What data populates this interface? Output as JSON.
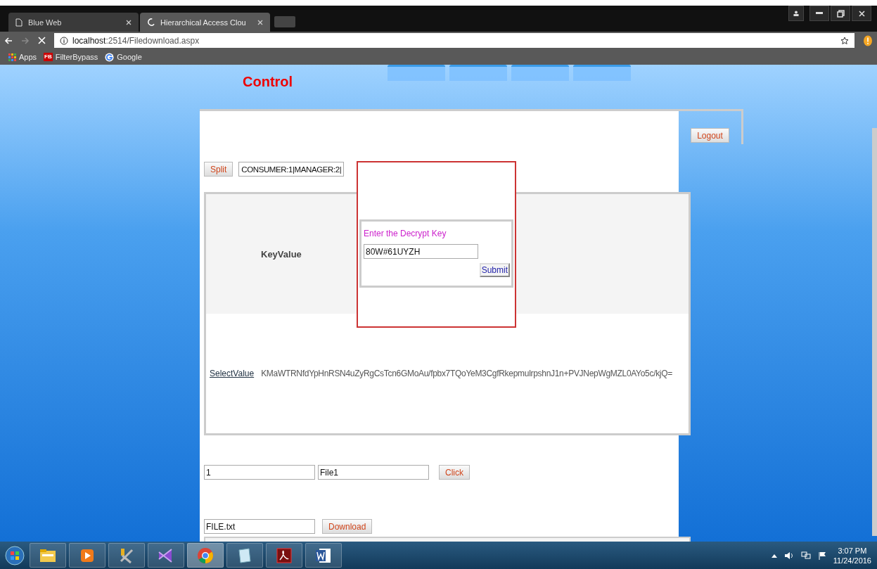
{
  "browser": {
    "tabs": [
      {
        "title": "Blue Web",
        "selected": false
      },
      {
        "title": "Hierarchical Access Clou",
        "selected": true
      }
    ],
    "url": {
      "host": "localhost",
      "path": ":2514/Filedownload.aspx"
    },
    "bookmarks": [
      {
        "label": "Apps",
        "kind": "apps"
      },
      {
        "label": "FilterBypass",
        "kind": "fb",
        "badge": "FB"
      },
      {
        "label": "Google",
        "kind": "google"
      }
    ]
  },
  "page": {
    "title": "Control",
    "logout": "Logout",
    "split": {
      "button": "Split",
      "value": "CONSUMER:1|MANAGER:2|"
    },
    "table": {
      "key_label": "KeyValue",
      "select_link": "SelectValue",
      "select_value": "KMaWTRNfdYpHnRSN4uZyRgCsTcn6GMoAu/fpbx7TQoYeM3CgfRkepmulrpshnJ1n+PVJNepWgMZL0AYo5c/kjQ="
    },
    "dialog": {
      "prompt": "Enter the Decrypt Key",
      "key": "80W#61UYZH",
      "submit": "Submit"
    },
    "file_form": {
      "id": "1",
      "name": "File1",
      "button": "Click"
    },
    "download": {
      "file": "FILE.txt",
      "button": "Download"
    }
  },
  "taskbar": {
    "apps": [
      {
        "kind": "explorer",
        "selected": false
      },
      {
        "kind": "media",
        "selected": false
      },
      {
        "kind": "tools",
        "selected": false
      },
      {
        "kind": "vs",
        "selected": false
      },
      {
        "kind": "chrome",
        "selected": true
      },
      {
        "kind": "notepad",
        "selected": false
      },
      {
        "kind": "pdf",
        "selected": false
      },
      {
        "kind": "word",
        "selected": false
      }
    ],
    "time": "3:07 PM",
    "date": "11/24/2016"
  }
}
